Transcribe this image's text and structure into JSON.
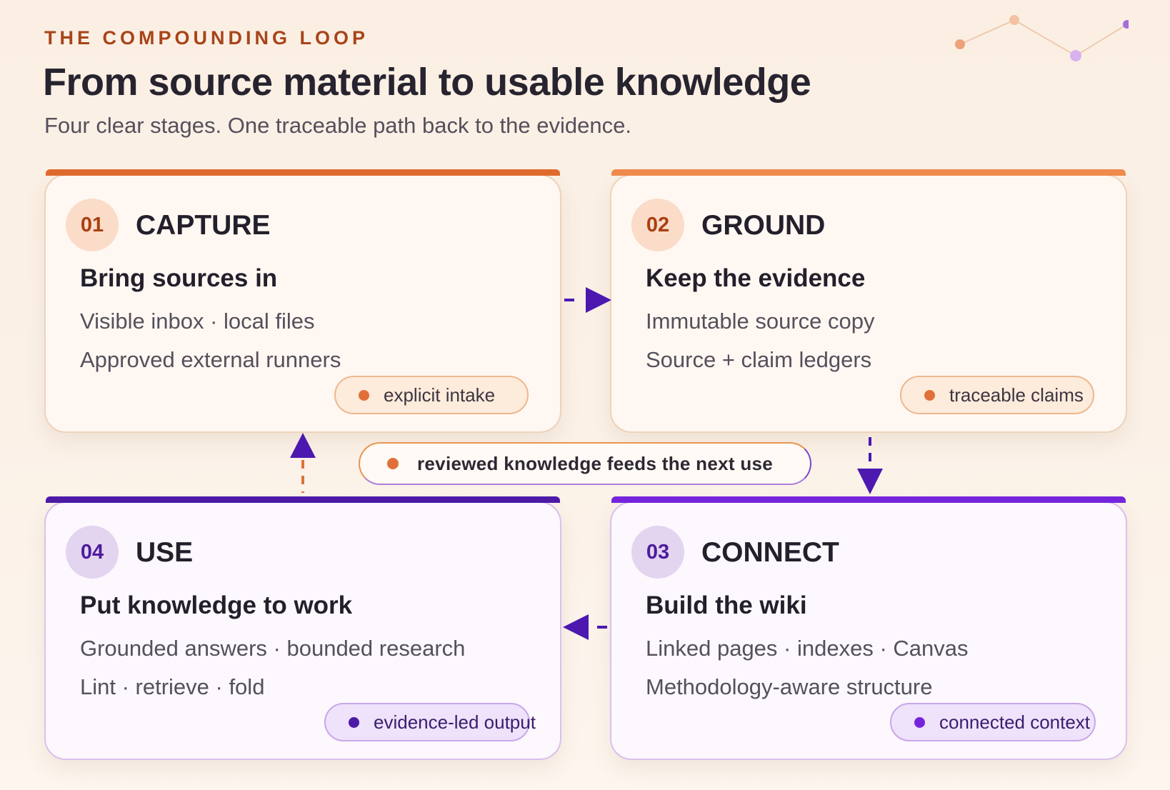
{
  "header": {
    "eyebrow": "THE COMPOUNDING LOOP",
    "title": "From source material to usable knowledge",
    "subtitle": "Four clear stages. One traceable path back to the evidence."
  },
  "cards": [
    {
      "number": "01",
      "stage": "CAPTURE",
      "heading": "Bring sources in",
      "lines": [
        "Visible inbox · local files",
        "Approved external runners"
      ],
      "pill": "explicit intake",
      "accent": "#e06a2e"
    },
    {
      "number": "02",
      "stage": "GROUND",
      "heading": "Keep the evidence",
      "lines": [
        "Immutable source copy",
        "Source + claim ledgers"
      ],
      "pill": "traceable claims",
      "accent": "#ee8a4c"
    },
    {
      "number": "03",
      "stage": "CONNECT",
      "heading": "Build the wiki",
      "lines": [
        "Linked pages · indexes · Canvas",
        "Methodology-aware structure"
      ],
      "pill": "connected context",
      "accent": "#7425db"
    },
    {
      "number": "04",
      "stage": "USE",
      "heading": "Put knowledge to work",
      "lines": [
        "Grounded answers · bounded research",
        "Lint · retrieve · fold"
      ],
      "pill": "evidence-led output",
      "accent": "#4d1aa6"
    }
  ],
  "loop_label": "reviewed knowledge feeds the next use",
  "colors": {
    "arrow": "#4d18b0",
    "arrow_return_dash": "#e07038",
    "deco_warm": "#eea27a",
    "deco_cool": "#b98be0"
  }
}
